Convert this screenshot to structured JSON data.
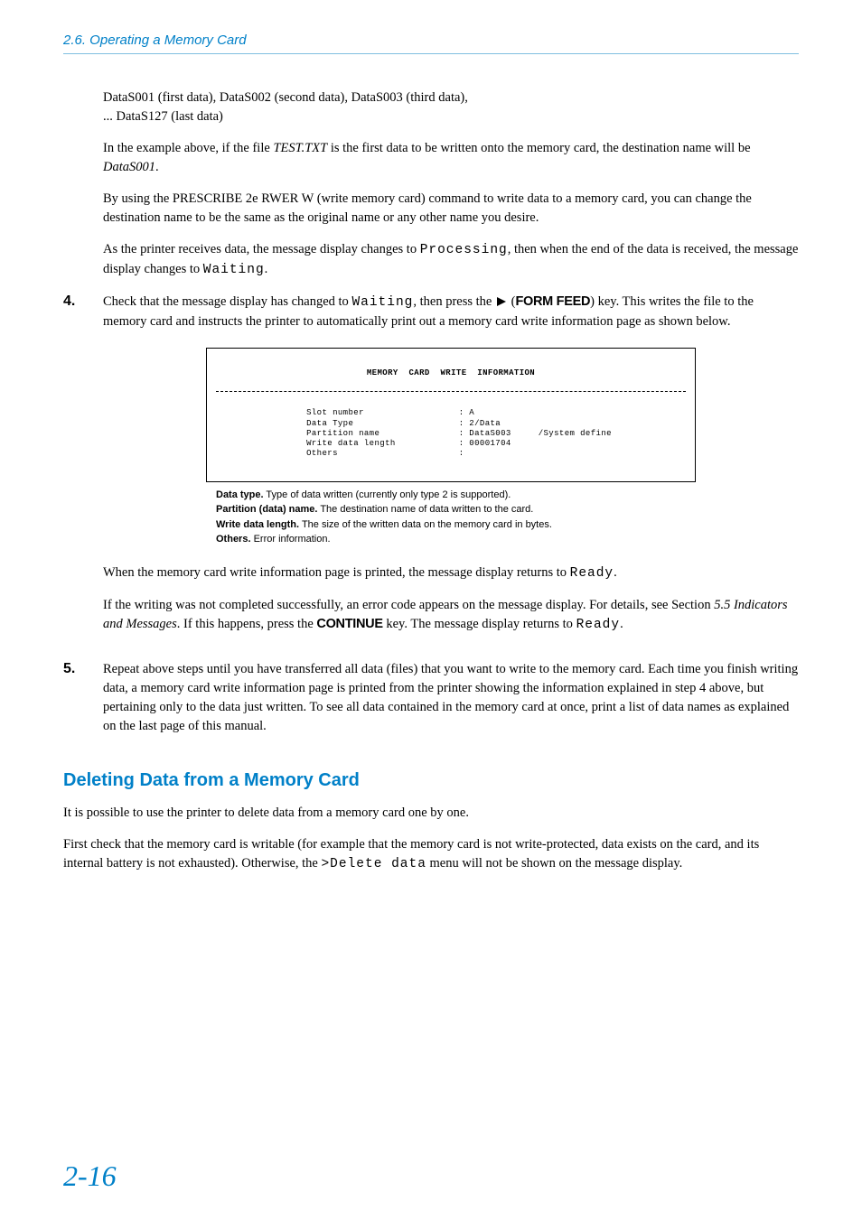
{
  "header": {
    "section": "2.6. Operating a Memory Card"
  },
  "content": {
    "intro1": "DataS001 (first data), DataS002 (second data), DataS003 (third data),",
    "intro2": "... DataS127 (last data)",
    "example_p1_a": "In the example above, if the file ",
    "example_file": "TEST.TXT",
    "example_p1_b": " is the first data to be written onto the memory card, the destination name will be ",
    "example_dest": "DataS001",
    "example_p1_c": ".",
    "prescribe": "By using the PRESCRIBE 2e RWER W (write memory card) command to write data to a memory card, you can change the destination name to be the same as the original name or any other name you desire.",
    "receives_a": "As the printer receives data, the message display changes to ",
    "processing": "Processing",
    "receives_b": ", then when the end of the data is received, the message display changes to ",
    "waiting1": "Waiting",
    "receives_c": ".",
    "step4_a": "Check that the message display has changed to ",
    "step4_wait": "Waiting",
    "step4_b": ", then press the ",
    "step4_key": "FORM FEED",
    "step4_c": ") key. This writes the file to the memory card and instructs the printer to automatically print out a memory card write information page as shown below.",
    "after_print_a": "When the memory card write information page is printed, the message display returns to ",
    "ready1": "Ready",
    "after_print_b": ".",
    "error_a": "If the writing was not completed successfully, an error code appears on the message display. For details, see Section ",
    "error_ref": "5.5 Indicators and Messages",
    "error_b": ". If this happens, press the ",
    "continue_key": "CONTINUE",
    "error_c": " key. The message display returns to ",
    "ready2": "Ready",
    "error_d": ".",
    "step5": "Repeat above steps until you have transferred all data (files) that you want to write to the memory card. Each time you finish writing data, a memory card write information page is printed from the printer showing the information explained in step 4 above, but pertaining only to the data just written. To see all data contained in the memory card at once, print a list of data names as explained on the last page of this manual."
  },
  "printout": {
    "title": "MEMORY CARD   WRITE   INFORMATION",
    "rows": [
      {
        "label": "Slot number",
        "colonval": ": A",
        "extra": ""
      },
      {
        "label": "Data Type",
        "colonval": ": 2/Data",
        "extra": ""
      },
      {
        "label": "Partition name",
        "colonval": ": DataS003",
        "extra": "/System define"
      },
      {
        "label": "Write data length",
        "colonval": ": 00001704",
        "extra": ""
      },
      {
        "label": "Others",
        "colonval": ":",
        "extra": ""
      }
    ]
  },
  "legend": {
    "l1_bold": "Data type.",
    "l1_text": " Type of data written (currently only type 2 is supported).",
    "l2_bold": "Partition (data) name.",
    "l2_text": " The destination name of data written to the card.",
    "l3_bold": "Write data length.",
    "l3_text": " The size of the written data on the memory card in bytes.",
    "l4_bold": "Others.",
    "l4_text": " Error information."
  },
  "delete_section": {
    "heading": "Deleting Data from a Memory Card",
    "p1": "It is possible to use the printer to delete data from a memory card one by one.",
    "p2_a": "First check that the memory card is writable (for example that the memory card is not write-protected, data exists on the card, and its internal battery is not exhausted). Otherwise, the ",
    "p2_cmd": ">Delete data",
    "p2_b": " menu will not be shown on the message display."
  },
  "footer": {
    "page_number": "2-16"
  },
  "step_numbers": {
    "four": "4.",
    "five": "5."
  }
}
